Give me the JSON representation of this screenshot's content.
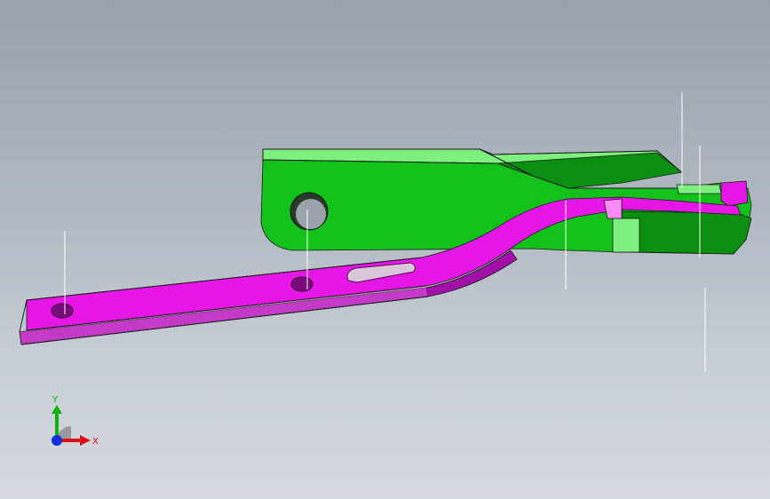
{
  "viewport": {
    "background_top": "#98a1ac",
    "background_bottom": "#d4d9df"
  },
  "model": {
    "bracket_part": {
      "color": "#12c21b",
      "shadow_color": "#0a8f10",
      "highlight_color": "#7df07f"
    },
    "arm_part": {
      "color": "#e616e6",
      "shadow_color": "#a10fa8",
      "highlight_color": "#ff8cff"
    },
    "edge_color": "#1a1a1a"
  },
  "triad": {
    "x_label": "X",
    "y_label": "Y",
    "x_color": "#e01010",
    "y_color": "#10b010",
    "z_color": "#1030e0"
  }
}
